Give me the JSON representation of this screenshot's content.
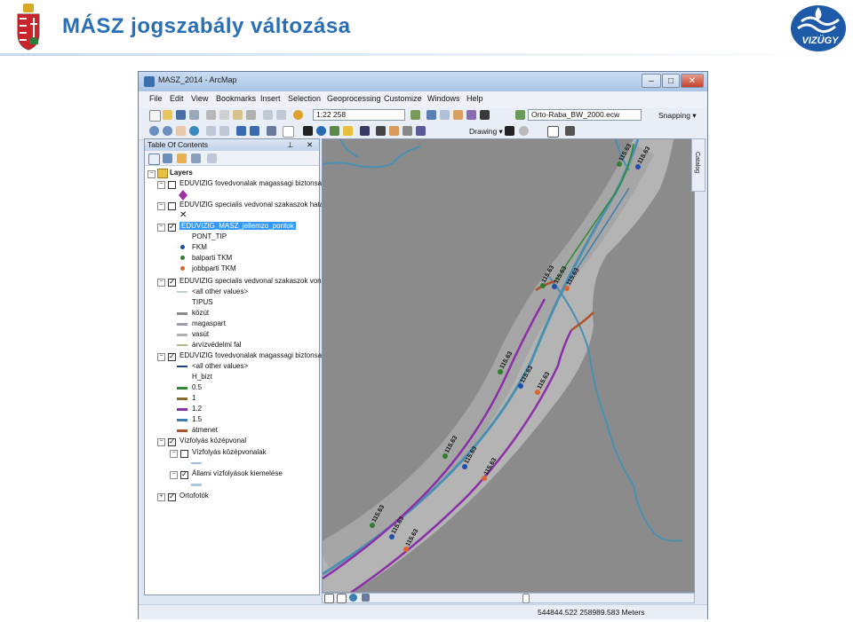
{
  "slide": {
    "title": "MÁSZ jogszabály változása",
    "logo_text": "VIZÜGY"
  },
  "window": {
    "title": "MASZ_2014 - ArcMap",
    "buttons": {
      "minimize": "–",
      "maximize": "□",
      "close": "✕"
    }
  },
  "menu": [
    "File",
    "Edit",
    "View",
    "Bookmarks",
    "Insert",
    "Selection",
    "Geoprocessing",
    "Customize",
    "Windows",
    "Help"
  ],
  "toolbar": {
    "scale": "1:22 258",
    "layer_combo": "Orto-Raba_BW_2000.ecw",
    "snapping": "Snapping ▾",
    "drawing": "Drawing ▾"
  },
  "toc": {
    "title": "Table Of Contents",
    "close": "✕",
    "root": "Layers",
    "layers": [
      {
        "label": "EDUVIZIG fovedvonalak magassagi biztonsa",
        "checked": false
      },
      {
        "label": "EDUVIZIG specialis vedvonal szakaszok hata",
        "checked": false
      },
      {
        "label": "EDUVIZIG_MASZ_jellemzo_pontok",
        "checked": true
      },
      {
        "label": "EDUVIZIG specialis vedvonal szakaszok von",
        "checked": true
      },
      {
        "label": "EDUVIZIG fovedvonalak magassagi biztonsa",
        "checked": true
      },
      {
        "label": "Vízfolyás középvonal",
        "checked": true
      },
      {
        "label": "Vízfolyás középvonalak",
        "checked": false
      },
      {
        "label": "Állami vízfolyások kiemelése",
        "checked": true
      },
      {
        "label": "Ortofotók",
        "checked": true
      }
    ],
    "pont_field": "PONT_TIP",
    "pont_legend": [
      {
        "label": "FKM",
        "color": "#1f4fa8"
      },
      {
        "label": "balparti TKM",
        "color": "#2f7d2f"
      },
      {
        "label": "jobbparti TKM",
        "color": "#e0632a"
      }
    ],
    "tipus_other": "<all other values>",
    "tipus_field": "TIPUS",
    "tipus_legend": [
      {
        "label": "közút",
        "color": "#8a8a8a"
      },
      {
        "label": "magaspart",
        "color": "#9a9ab0"
      },
      {
        "label": "vasút",
        "color": "#b0b0b0"
      },
      {
        "label": "árvízvédelmi fal",
        "color": "#b5b58a"
      }
    ],
    "hbizt_other": "<all other values>",
    "hbizt_field": "H_bizt",
    "hbizt_legend": [
      {
        "label": "0.5",
        "color": "#2f8a2f"
      },
      {
        "label": "1",
        "color": "#8a6a2a"
      },
      {
        "label": "1.2",
        "color": "#8b2fa8"
      },
      {
        "label": "1.5",
        "color": "#3a7fb0"
      },
      {
        "label": "átmenet",
        "color": "#b0502a"
      }
    ]
  },
  "map": {
    "labels": [
      "115.63",
      "115.63",
      "115.63",
      "115.63",
      "115.63",
      "115.63",
      "115.63",
      "115.63",
      "115.63",
      "115.63",
      "115.63",
      "115.63",
      "115.63",
      "115.63"
    ],
    "colors": {
      "river": "#4a8fb0",
      "purple": "#8b2fa8",
      "background": "#8b8b8b"
    }
  },
  "catalog": "Catalog",
  "status": {
    "coords": "544844.522  258989.583 Meters"
  }
}
